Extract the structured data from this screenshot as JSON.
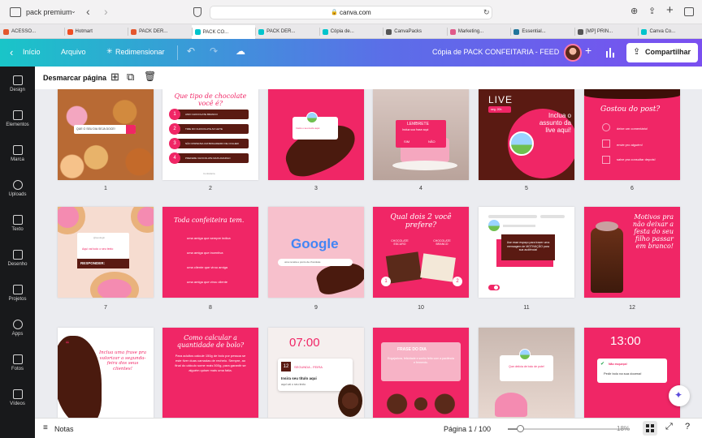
{
  "browser": {
    "profile": "pack premium",
    "url": "canva.com",
    "tabs": [
      {
        "label": "ACESSO...",
        "color": "#e4572e"
      },
      {
        "label": "Hotmart",
        "color": "#f04e23"
      },
      {
        "label": "PACK DER...",
        "color": "#e4572e"
      },
      {
        "label": "PACK CO...",
        "color": "#00c4cc"
      },
      {
        "label": "PACK DER...",
        "color": "#00c4cc"
      },
      {
        "label": "Cópia de...",
        "color": "#00c4cc"
      },
      {
        "label": "CanvaPacks",
        "color": "#555555"
      },
      {
        "label": "Marketing...",
        "color": "#e05a8a"
      },
      {
        "label": "Essential...",
        "color": "#21759b"
      },
      {
        "label": "[MP] PRIN...",
        "color": "#555555"
      },
      {
        "label": "Canva Co...",
        "color": "#00c4cc"
      }
    ]
  },
  "toolbar": {
    "home": "Início",
    "file": "Arquivo",
    "resize": "Redimensionar",
    "doc_title": "Cópia de PACK CONFEITARIA - FEED",
    "share": "Compartilhar"
  },
  "sidebar": {
    "items": [
      {
        "label": "Design",
        "icon": "layout-icon"
      },
      {
        "label": "Elementos",
        "icon": "shapes-icon"
      },
      {
        "label": "Marca",
        "icon": "brand-icon"
      },
      {
        "label": "Uploads",
        "icon": "upload-icon"
      },
      {
        "label": "Texto",
        "icon": "text-icon"
      },
      {
        "label": "Desenho",
        "icon": "draw-icon"
      },
      {
        "label": "Projetos",
        "icon": "folder-icon"
      },
      {
        "label": "Apps",
        "icon": "apps-icon"
      },
      {
        "label": "Fotos",
        "icon": "photos-icon"
      },
      {
        "label": "Vídeos",
        "icon": "video-icon"
      }
    ]
  },
  "pagebar": {
    "deselect": "Desmarcar página"
  },
  "pages": [
    {
      "num": "1",
      "search_text": "QUE O SEU DIA SEJA DOCE!"
    },
    {
      "num": "2",
      "title": "Que tipo de chocolate você é?",
      "options": [
        "AMO CHOCOLATE BRANCO",
        "TIME DO CHOCOLATE AO LEITE",
        "NÃO DISPENSA UM BRIGADEIRO DE COLHER",
        "PREFERE CHOCOLATE MAIS AMARGO"
      ],
      "brand": "Confeitaria"
    },
    {
      "num": "3",
      "text": "Insira o seu texto aqui"
    },
    {
      "num": "4",
      "title": "LEMBRETE",
      "sub": "Inclua sua frase aqui",
      "yes": "SIM",
      "no": "NÃO"
    },
    {
      "num": "5",
      "live": "LIVE",
      "date": "seg. 20h",
      "text": "Inclua o assunto da live aqui!"
    },
    {
      "num": "6",
      "title": "Gostou do post?",
      "items": [
        "deixe um comentário!",
        "envie pro alguém!",
        "salve pra consultar depois!"
      ]
    },
    {
      "num": "7",
      "handle": "@seulogin",
      "text": "Aqui vai todo o seu texto",
      "reply": "RESPONDER:"
    },
    {
      "num": "8",
      "title": "Toda confeiteira tem.",
      "items": [
        "uma amiga que sempre indica",
        "uma amiga que incentiva",
        "uma cliente que virou amiga",
        "uma amiga que virou cliente"
      ]
    },
    {
      "num": "9",
      "logo": "Google",
      "search": "uma receita e ponto de chocolate"
    },
    {
      "num": "10",
      "title": "Qual dois 2 você prefere?",
      "left": "CHOCOLATE ESCURO",
      "right": "CHOCOLATE BRANCO",
      "a": "1",
      "b": "2"
    },
    {
      "num": "11",
      "text": "Use esse espaço para trazer uma mensagem de MOTIVAÇÃO para sua audiência!"
    },
    {
      "num": "12",
      "text": "Motivos pra não deixar a festa do seu filho passar em branco!"
    },
    {
      "num": "",
      "text": "Inclua uma frase pra valorizar a segunda-feira dos seus clientes!"
    },
    {
      "num": "",
      "title": "Como calcular a quantidade de bolo?",
      "body": "Para adultos calcule 150g de bolo por pessoa se este tiver duas camadas de recheio. Sempre, ao final do cálculo some mais 500g, para garantir se alguém quiser mais uma fatia."
    },
    {
      "num": "",
      "time": "07:00",
      "day": "12",
      "dayname": "SEGUNDA - FEIRA",
      "headline": "Insira seu título aqui",
      "sub": "aqui vai o seu texto"
    },
    {
      "num": "",
      "title": "FRASE DO DIA",
      "text": "Engajadora, felicidade e sonho feito com a paciência e fermento."
    },
    {
      "num": "",
      "text": "Que delícia de bolo de pote!"
    },
    {
      "num": "",
      "time": "13:00",
      "notif": "Não esqueça!",
      "text": "Pedir bolo na sua docena!"
    }
  ],
  "footer": {
    "notes": "Notas",
    "page_indicator": "Página 1 / 100",
    "zoom": "18%",
    "zoom_level": 0.18
  },
  "colors": {
    "accent": "#f02666",
    "brown": "#5a1a12",
    "sidebar": "#18191b"
  }
}
